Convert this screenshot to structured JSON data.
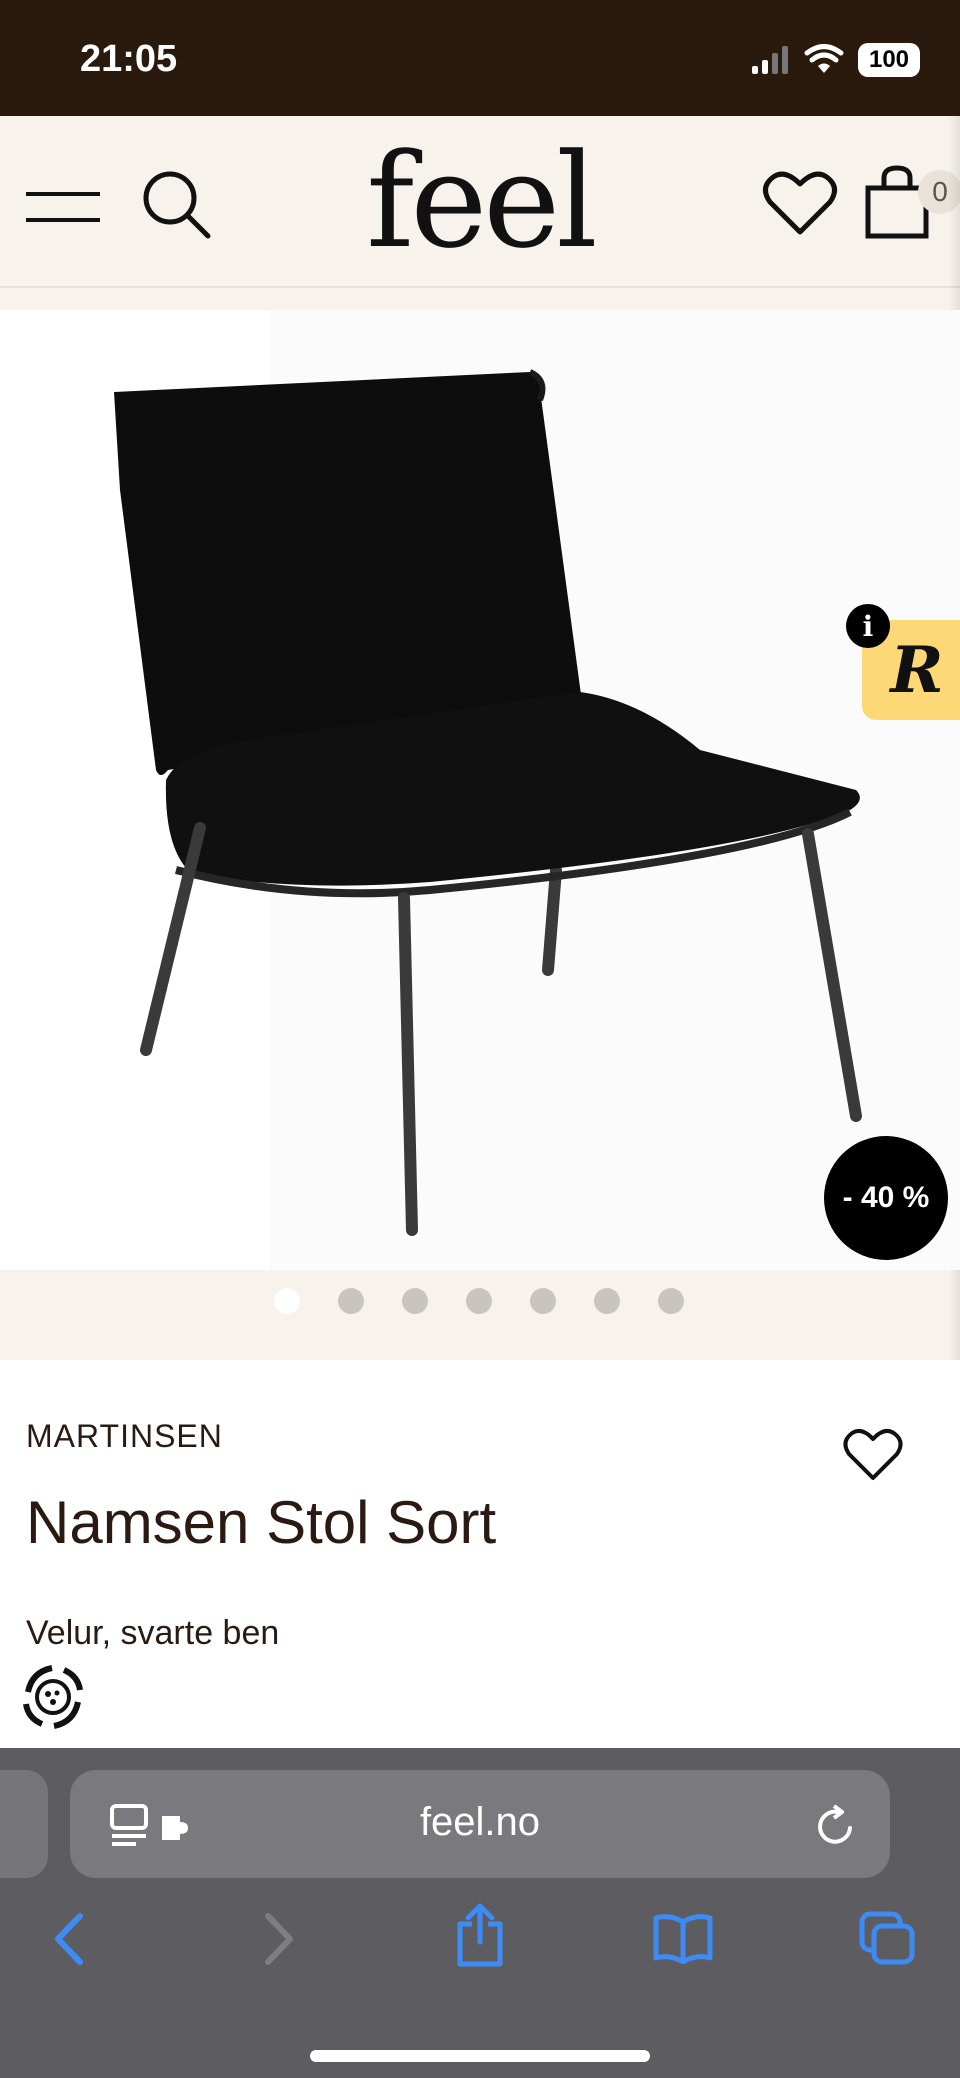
{
  "status_bar": {
    "time": "21:05",
    "battery": "100"
  },
  "header": {
    "logo": "feel",
    "cart_count": "0",
    "icons": [
      "menu-icon",
      "search-icon",
      "heart-icon",
      "cart-icon"
    ]
  },
  "gallery": {
    "discount": "- 40 %",
    "info_badge": "i",
    "retail_badge": "R",
    "dot_count": 7,
    "active_dot": 0
  },
  "product": {
    "brand": "MARTINSEN",
    "title": "Namsen Stol Sort",
    "subtitle": "Velur, svarte ben"
  },
  "browser": {
    "url": "feel.no",
    "toolbar": [
      "back-icon",
      "forward-icon",
      "share-icon",
      "bookmarks-icon",
      "tabs-icon"
    ]
  },
  "colors": {
    "status_bg": "#2a1a0e",
    "page_bg": "#f7f3ec",
    "text": "#2a1a12",
    "safari_bg": "#5d5c61",
    "link_blue": "#3d8bf5",
    "badge_yellow": "#fcd877"
  }
}
